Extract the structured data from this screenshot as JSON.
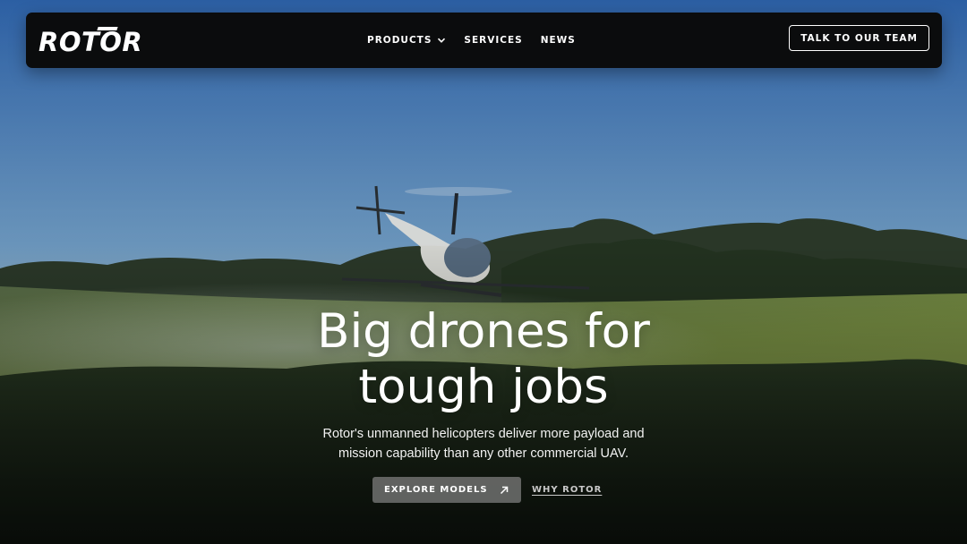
{
  "brand": {
    "logo_text": "ROTOR"
  },
  "nav": {
    "links": [
      {
        "label": "PRODUCTS",
        "has_dropdown": true
      },
      {
        "label": "SERVICES",
        "has_dropdown": false
      },
      {
        "label": "NEWS",
        "has_dropdown": false
      }
    ],
    "cta_label": "TALK TO OUR TEAM"
  },
  "hero": {
    "title_line1": "Big drones for",
    "title_line2": "tough jobs",
    "subtitle_line1": "Rotor's unmanned helicopters deliver more payload and",
    "subtitle_line2": "mission capability than any other commercial UAV.",
    "primary_button": "EXPLORE MODELS",
    "secondary_link": "WHY ROTOR"
  },
  "icons": {
    "nav_dropdown": "chevron-down-icon",
    "primary_button": "arrow-up-right-icon"
  },
  "colors": {
    "navbar_bg": "#0b0c0d",
    "sky_top": "#2e62a6",
    "sky_bottom": "#9fc3d9",
    "field": "#6f8a3e",
    "foliage": "#1d2e1c",
    "button_bg": "#787878"
  }
}
